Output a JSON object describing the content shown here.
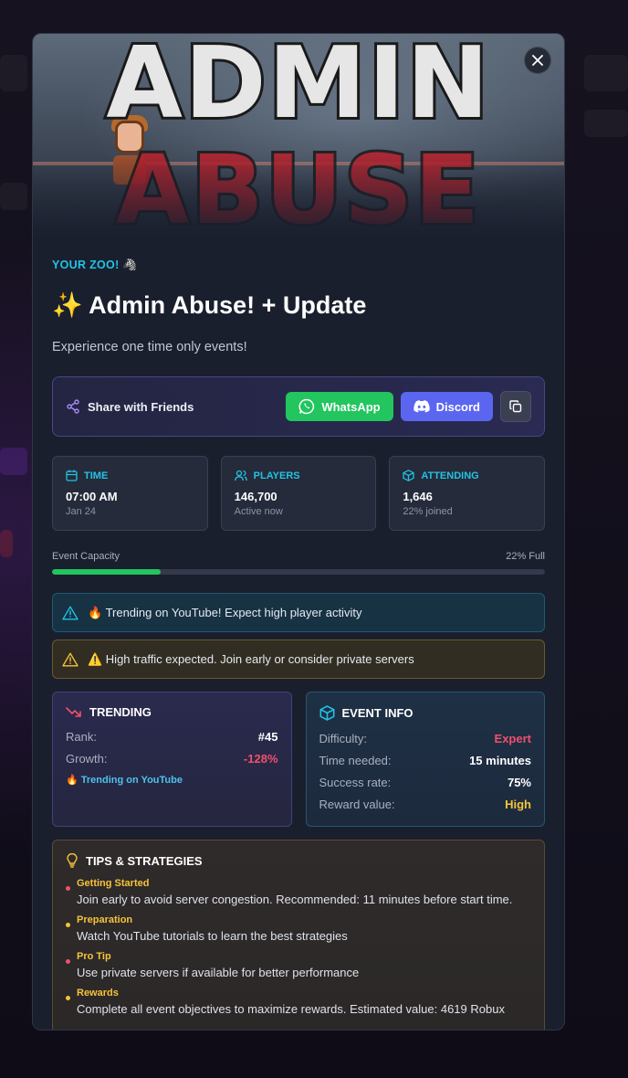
{
  "banner": {
    "line1": "ADMIN",
    "line2": "ABUSE"
  },
  "event": {
    "game_name": "YOUR ZOO! 🦓",
    "title": "✨ Admin Abuse! + Update",
    "description": "Experience one time only events!"
  },
  "share": {
    "label": "Share with Friends",
    "whatsapp": "WhatsApp",
    "discord": "Discord"
  },
  "stats": [
    {
      "label": "TIME",
      "value": "07:00 AM",
      "sub": "Jan 24",
      "icon": "calendar-icon"
    },
    {
      "label": "PLAYERS",
      "value": "146,700",
      "sub": "Active now",
      "icon": "users-icon"
    },
    {
      "label": "ATTENDING",
      "value": "1,646",
      "sub": "22% joined",
      "icon": "box-icon"
    }
  ],
  "capacity": {
    "label": "Event Capacity",
    "value_text": "22% Full",
    "fraction": 0.22,
    "color": "#22c55e"
  },
  "alerts": {
    "info": "🔥 Trending on YouTube! Expect high player activity",
    "warn": "⚠️ High traffic expected. Join early or consider private servers"
  },
  "trending": {
    "title": "TRENDING",
    "rank_label": "Rank:",
    "rank_value": "#45",
    "growth_label": "Growth:",
    "growth_value": "-128%",
    "note": "🔥 Trending on YouTube"
  },
  "event_info": {
    "title": "EVENT INFO",
    "rows": [
      {
        "label": "Difficulty:",
        "value": "Expert",
        "color": "#f0506e"
      },
      {
        "label": "Time needed:",
        "value": "15 minutes",
        "color": "#ffffff"
      },
      {
        "label": "Success rate:",
        "value": "75%",
        "color": "#ffffff"
      },
      {
        "label": "Reward value:",
        "value": "High",
        "color": "#f6c33a"
      }
    ]
  },
  "tips": {
    "title": "TIPS & STRATEGIES",
    "items": [
      {
        "title": "Getting Started",
        "text": "Join early to avoid server congestion. Recommended: 11 minutes before start time.",
        "dot": "#f0506e"
      },
      {
        "title": "Preparation",
        "text": "Watch YouTube tutorials to learn the best strategies",
        "dot": "#f6c33a"
      },
      {
        "title": "Pro Tip",
        "text": "Use private servers if available for better performance",
        "dot": "#f0506e"
      },
      {
        "title": "Rewards",
        "text": "Complete all event objectives to maximize rewards. Estimated value: 4619 Robux",
        "dot": "#f6c33a"
      }
    ]
  },
  "colors": {
    "accent": "#22c3e6",
    "whatsapp": "#22c55e",
    "discord": "#5b66f0"
  }
}
